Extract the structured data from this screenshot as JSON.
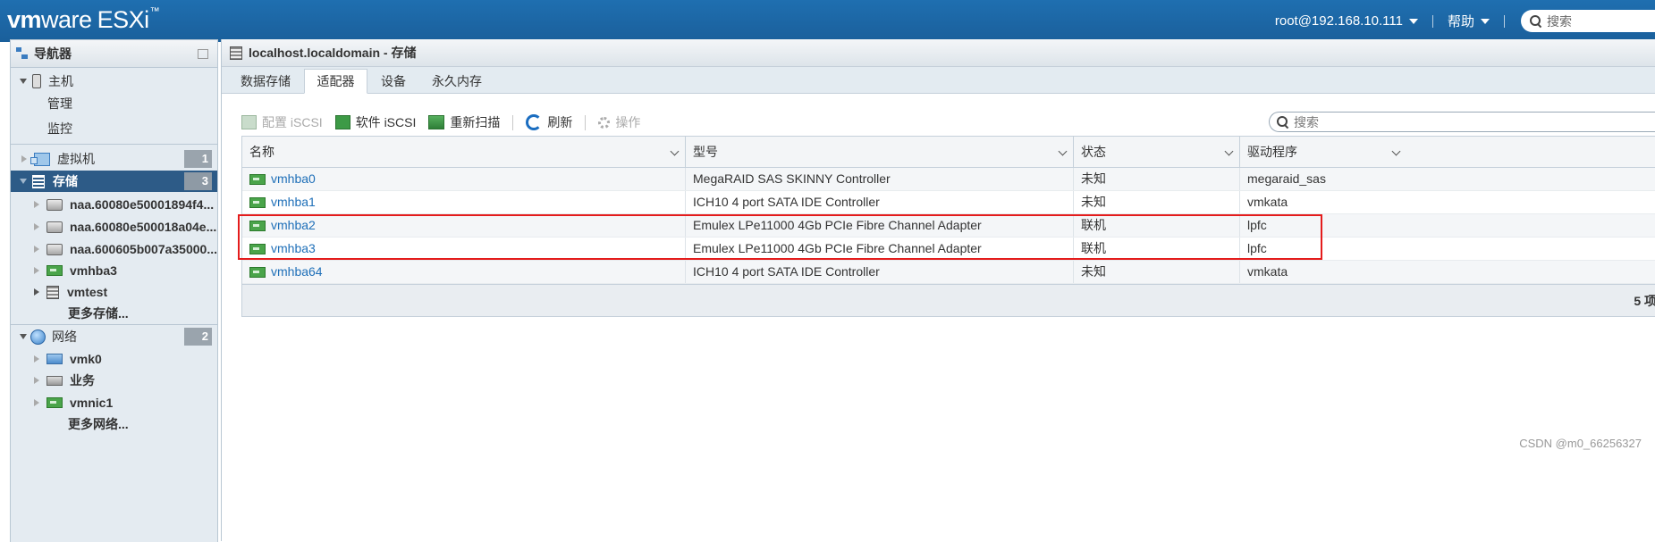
{
  "header": {
    "brand_vm": "vm",
    "brand_ware": "ware",
    "brand_product": "ESXi",
    "brand_tm": "™",
    "user": "root@192.168.10.111",
    "help": "帮助",
    "search_placeholder": "搜索"
  },
  "navigator": {
    "title": "导航器",
    "host": "主机",
    "host_children": [
      "管理",
      "监控"
    ],
    "vms": {
      "label": "虚拟机",
      "count": "1"
    },
    "storage": {
      "label": "存储",
      "count": "3"
    },
    "storage_items": [
      "naa.60080e50001894f4...",
      "naa.60080e500018a04e...",
      "naa.600605b007a35000...",
      "vmhba3",
      "vmtest"
    ],
    "storage_more": "更多存储...",
    "network": {
      "label": "网络",
      "count": "2"
    },
    "network_items": [
      "vmk0",
      "业务",
      "vmnic1"
    ],
    "network_more": "更多网络..."
  },
  "main": {
    "title": "localhost.localdomain - 存储",
    "tabs": [
      "数据存储",
      "适配器",
      "设备",
      "永久内存"
    ],
    "active_tab": "适配器",
    "toolbar": {
      "configure_iscsi": "配置 iSCSI",
      "software_iscsi": "软件 iSCSI",
      "rescan": "重新扫描",
      "refresh": "刷新",
      "actions": "操作"
    },
    "search_placeholder": "搜索",
    "columns": [
      "名称",
      "型号",
      "状态",
      "驱动程序"
    ],
    "rows": [
      {
        "name": "vmhba0",
        "model": "MegaRAID SAS SKINNY Controller",
        "status": "未知",
        "driver": "megaraid_sas"
      },
      {
        "name": "vmhba1",
        "model": "ICH10 4 port SATA IDE Controller",
        "status": "未知",
        "driver": "vmkata"
      },
      {
        "name": "vmhba2",
        "model": "Emulex LPe11000 4Gb PCIe Fibre Channel Adapter",
        "status": "联机",
        "driver": "lpfc"
      },
      {
        "name": "vmhba3",
        "model": "Emulex LPe11000 4Gb PCIe Fibre Channel Adapter",
        "status": "联机",
        "driver": "lpfc"
      },
      {
        "name": "vmhba64",
        "model": "ICH10 4 port SATA IDE Controller",
        "status": "未知",
        "driver": "vmkata"
      }
    ],
    "count": "5 项"
  },
  "watermark": "CSDN @m0_66256327",
  "colors": {
    "header": "#1f6fb0",
    "selected": "#2d5b87",
    "link": "#1e6fb8",
    "highlight": "#e41c1c"
  }
}
